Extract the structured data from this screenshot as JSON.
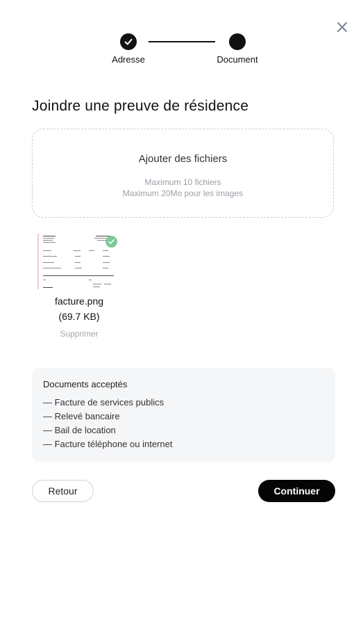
{
  "stepper": {
    "steps": [
      {
        "label": "Adresse",
        "state": "completed"
      },
      {
        "label": "Document",
        "state": "current"
      }
    ]
  },
  "title": "Joindre une preuve de résidence",
  "dropzone": {
    "title": "Ajouter des fichiers",
    "hint_max_files": "Maximum 10 fichiers",
    "hint_max_size": "Maximum 20Mo pour les images"
  },
  "files": [
    {
      "name": "facture.png",
      "size": "(69.7 KB)",
      "delete_label": "Supprimer",
      "status": "uploaded"
    }
  ],
  "accepted_documents": {
    "title": "Documents acceptés",
    "items": [
      "— Facture de services publics",
      "— Relevé bancaire",
      "— Bail de location",
      "— Facture téléphone ou internet"
    ]
  },
  "buttons": {
    "back": "Retour",
    "continue": "Continuer"
  },
  "colors": {
    "primary": "#050505",
    "success": "#7dc99a",
    "panel_background": "#f5f6f8",
    "muted_text": "#9aa0a8"
  },
  "icons": {
    "close": "close-icon",
    "step_done": "check-icon",
    "file_status": "check-icon"
  }
}
